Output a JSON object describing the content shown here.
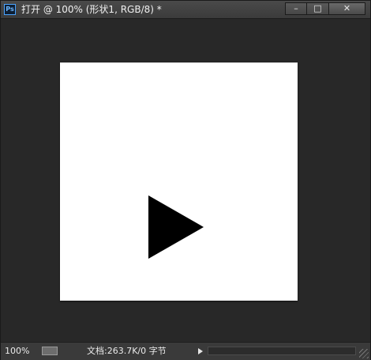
{
  "window": {
    "app_icon_label": "Ps",
    "title": "打开 @ 100% (形状1, RGB/8) *",
    "controls": {
      "minimize": "–",
      "maximize": "□",
      "close": "✕"
    }
  },
  "canvas": {
    "document_bg": "#ffffff",
    "shape_color": "#000000",
    "shape_icon": "play-triangle-icon"
  },
  "status": {
    "zoom": "100%",
    "doc_info": "文档:263.7K/0 字节"
  }
}
